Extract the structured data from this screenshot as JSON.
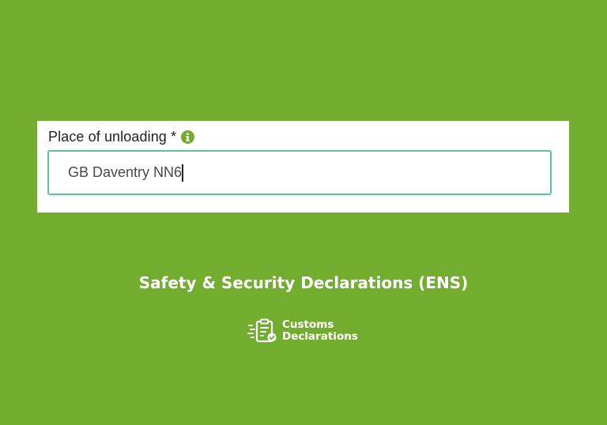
{
  "form": {
    "field_label": "Place of unloading *",
    "info_icon": "info-circle-icon",
    "input_value": "GB Daventry NN6",
    "accent_color": "#72ad2f",
    "input_border_color": "#5cc59a"
  },
  "banner": {
    "background_color": "#72ad2f",
    "headline": "Safety & Security Declarations (ENS)"
  },
  "brand": {
    "logo_icon": "clipboard-check-icon",
    "line1": "Customs",
    "line2": "Declarations"
  }
}
